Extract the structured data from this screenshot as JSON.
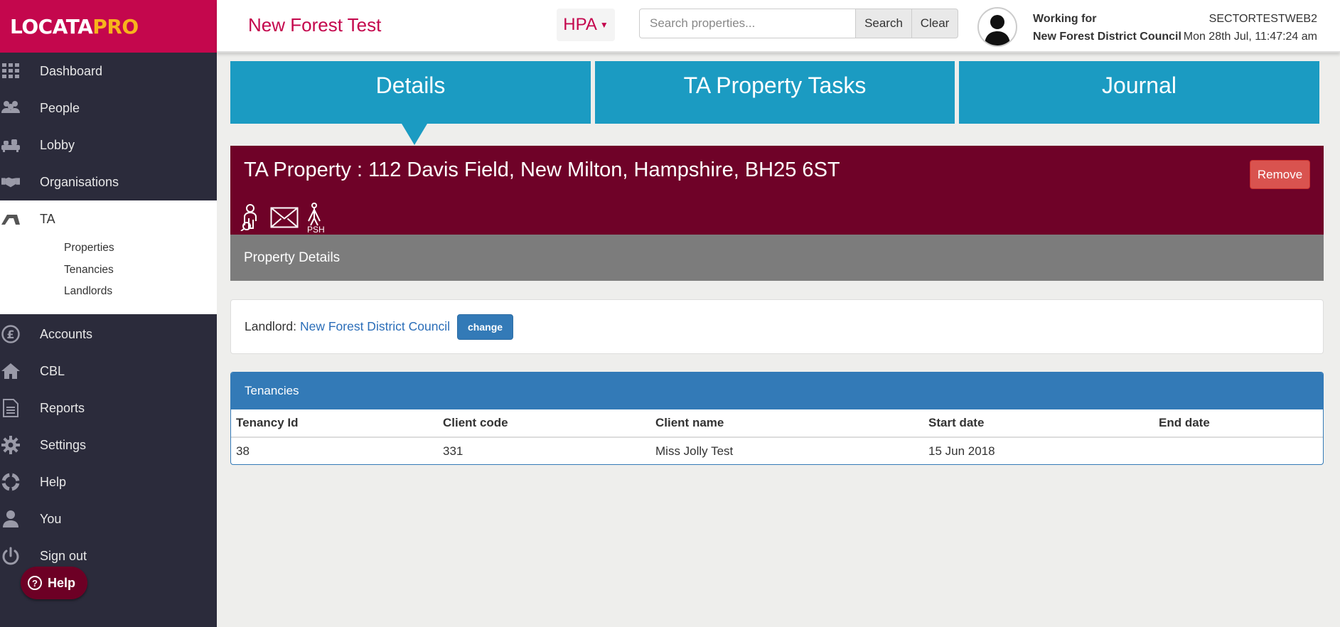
{
  "logo": {
    "part1": "LOCATA",
    "part2": "PRO"
  },
  "nav": {
    "top": [
      {
        "label": "Dashboard",
        "icon": "grid-icon"
      },
      {
        "label": "People",
        "icon": "people-icon"
      },
      {
        "label": "Lobby",
        "icon": "lobby-icon"
      },
      {
        "label": "Organisations",
        "icon": "handshake-icon"
      }
    ],
    "ta": {
      "label": "TA",
      "icon": "ta-icon",
      "subitems": [
        "Properties",
        "Tenancies",
        "Landlords"
      ]
    },
    "bottom": [
      {
        "label": "Accounts",
        "icon": "pound-icon"
      },
      {
        "label": "CBL",
        "icon": "house-icon"
      },
      {
        "label": "Reports",
        "icon": "document-icon"
      },
      {
        "label": "Settings",
        "icon": "gear-icon"
      },
      {
        "label": "Help",
        "icon": "lifebuoy-icon"
      },
      {
        "label": "You",
        "icon": "user-icon"
      },
      {
        "label": "Sign out",
        "icon": "power-icon"
      }
    ],
    "help_pill": "Help"
  },
  "header": {
    "site_title": "New Forest Test",
    "module": "HPA",
    "search_placeholder": "Search properties...",
    "search_label": "Search",
    "clear_label": "Clear",
    "working_for_label": "Working for",
    "organisation": "New Forest District Council",
    "username": "SECTORTESTWEB2",
    "datetime": "Mon 28th Jul, 11:47:24 am"
  },
  "tabs": [
    "Details",
    "TA Property Tasks",
    "Journal"
  ],
  "property": {
    "title": "TA Property : 112 Davis Field, New Milton, Hampshire, BH25 6ST",
    "remove_label": "Remove",
    "icons": [
      "person-search-icon",
      "envelope-icon",
      "psh-icon"
    ],
    "psh_text": "PSH",
    "details_label": "Property Details"
  },
  "landlord": {
    "label": "Landlord:",
    "name": "New Forest District Council",
    "change_label": "change"
  },
  "tenancies": {
    "title": "Tenancies",
    "columns": [
      "Tenancy Id",
      "Client code",
      "Client name",
      "Start date",
      "End date"
    ],
    "rows": [
      [
        "38",
        "331",
        "Miss Jolly Test",
        "15 Jun 2018",
        ""
      ]
    ]
  },
  "colors": {
    "brand": "#c4074d",
    "sidebar": "#2b2b3b",
    "tab": "#1b9bc2",
    "property_header": "#6f0228",
    "remove": "#d9534f",
    "panel": "#337ab7"
  }
}
